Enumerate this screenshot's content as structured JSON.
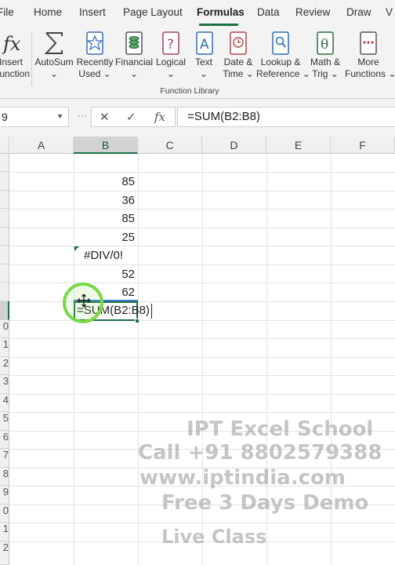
{
  "tabs": [
    {
      "label": "File",
      "active": false
    },
    {
      "label": "Home",
      "active": false
    },
    {
      "label": "Insert",
      "active": false
    },
    {
      "label": "Page Layout",
      "active": false
    },
    {
      "label": "Formulas",
      "active": true
    },
    {
      "label": "Data",
      "active": false
    },
    {
      "label": "Review",
      "active": false
    },
    {
      "label": "Draw",
      "active": false
    },
    {
      "label": "V",
      "active": false
    }
  ],
  "ribbon": {
    "insert_function": {
      "line1": "Insert",
      "line2": "Function",
      "icon": "fx-icon"
    },
    "autosum": {
      "line1": "AutoSum",
      "icon": "sigma-icon"
    },
    "recently_used": {
      "line1": "Recently",
      "line2": "Used",
      "icon": "star-icon"
    },
    "financial": {
      "line1": "Financial",
      "icon": "coins-icon"
    },
    "logical": {
      "line1": "Logical",
      "icon": "question-book-icon"
    },
    "text": {
      "line1": "Text",
      "icon": "text-book-icon"
    },
    "date_time": {
      "line1": "Date &",
      "line2": "Time",
      "icon": "clock-book-icon"
    },
    "lookup_reference": {
      "line1": "Lookup &",
      "line2": "Reference",
      "icon": "magnifier-book-icon"
    },
    "math_trig": {
      "line1": "Math &",
      "line2": "Trig",
      "icon": "theta-book-icon"
    },
    "more_functions": {
      "line1": "More",
      "line2": "Functions",
      "icon": "more-book-icon"
    },
    "group_label": "Function Library"
  },
  "formula_bar": {
    "name_box": "9",
    "formula": "=SUM(B2:B8)",
    "cancel_symbol": "✕",
    "enter_symbol": "✓",
    "fx_symbol": "fx"
  },
  "columns": [
    "A",
    "B",
    "C",
    "D",
    "E",
    "F"
  ],
  "selected_column": "B",
  "rows": [
    "",
    "",
    "",
    "",
    "",
    "",
    "",
    "",
    "",
    "0",
    "1",
    "2",
    "3",
    "4",
    "5",
    "6",
    "7",
    "8",
    "9",
    "0",
    "1",
    "2"
  ],
  "cells": {
    "b2": "85",
    "b3": "36",
    "b4": "85",
    "b5": "25",
    "b6": "#DIV/0!",
    "b7": "52",
    "b8": "62",
    "b9": "=SUM(B2:B8)"
  },
  "colors": {
    "accent": "#1e7145",
    "ribbon_bg": "#f3f3f3",
    "cursor_highlight": "#7bd84a",
    "range_highlight": "#3b7bd4"
  },
  "watermark": {
    "line1": "IPT Excel School",
    "line2": "Call +91 8802579388",
    "line3": "www.iptindia.com",
    "line4": "Free 3 Days Demo",
    "line5": "Live Class"
  }
}
